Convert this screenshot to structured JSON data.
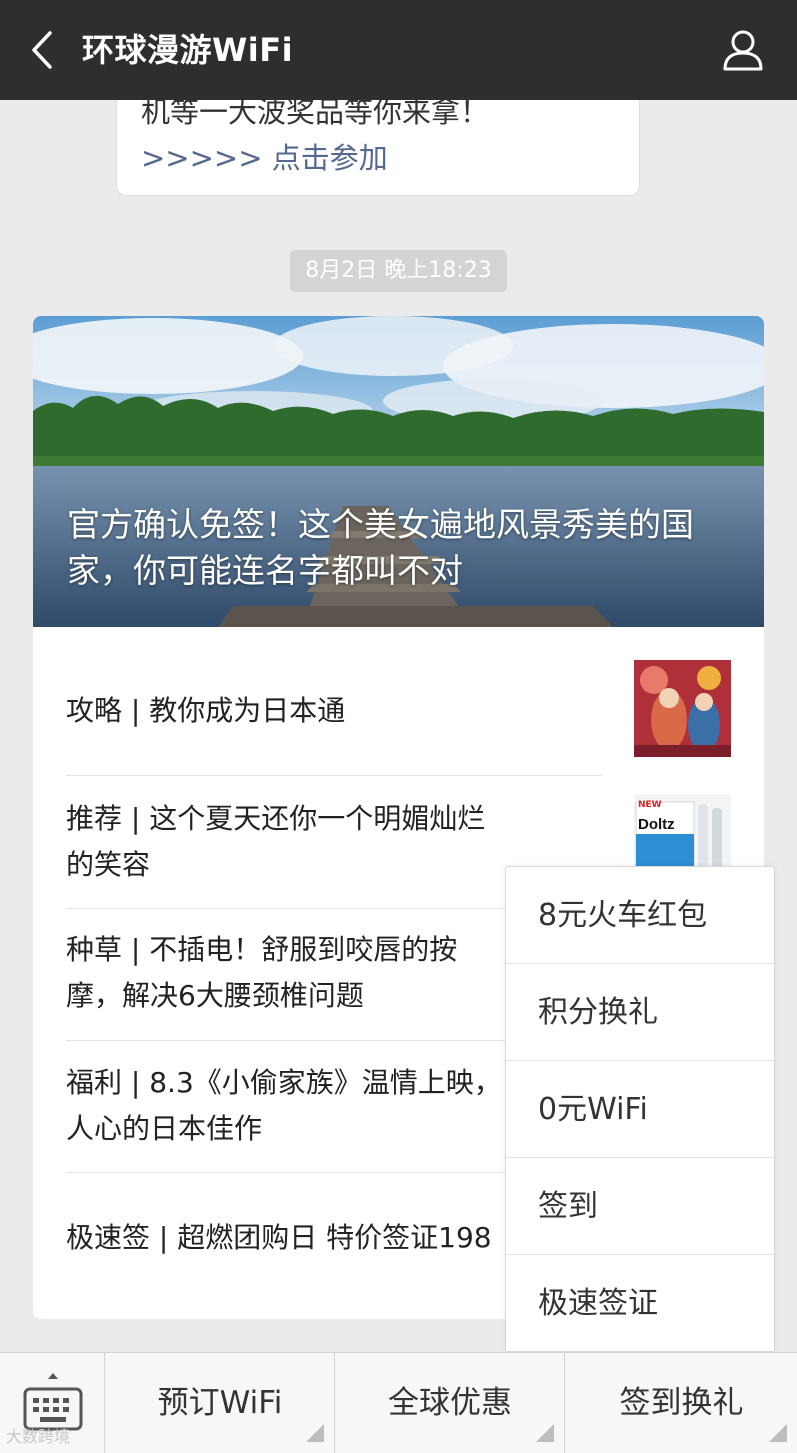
{
  "header": {
    "title": "环球漫游WiFi",
    "back_icon": "chevron-left-icon",
    "profile_icon": "person-icon"
  },
  "previous_message": {
    "line": "机等一大波奖品等你来拿！",
    "link": ">>>>> 点击参加"
  },
  "timestamp": "8月2日 晚上18:23",
  "article": {
    "cover_title": "官方确认免签！这个美女遍地风景秀美的国家，你可能连名字都叫不对",
    "items": [
      {
        "title": "攻略 | 教你成为日本通"
      },
      {
        "title": "推荐 | 这个夏天还你一个明媚灿烂的笑容"
      },
      {
        "title": "种草 | 不插电！舒服到咬唇的按摩，解决6大腰颈椎问题"
      },
      {
        "title": "福利 | 8.3《小偷家族》温情上映，人心的日本佳作"
      },
      {
        "title": "极速签 | 超燃团购日 特价签证198"
      }
    ],
    "thumb2_brand": "Doltz",
    "thumb2_new": "NEW"
  },
  "popup_menu": {
    "items": [
      "8元火车红包",
      "积分换礼",
      "0元WiFi",
      "签到",
      "极速签证"
    ]
  },
  "bottom_bar": {
    "keyboard_icon": "keyboard-icon",
    "tabs": [
      "预订WiFi",
      "全球优惠",
      "签到换礼"
    ]
  },
  "watermark": "大数跨境",
  "colors": {
    "header_bg": "#2e2e2e",
    "page_bg": "#ebebeb",
    "link": "#55688f"
  }
}
